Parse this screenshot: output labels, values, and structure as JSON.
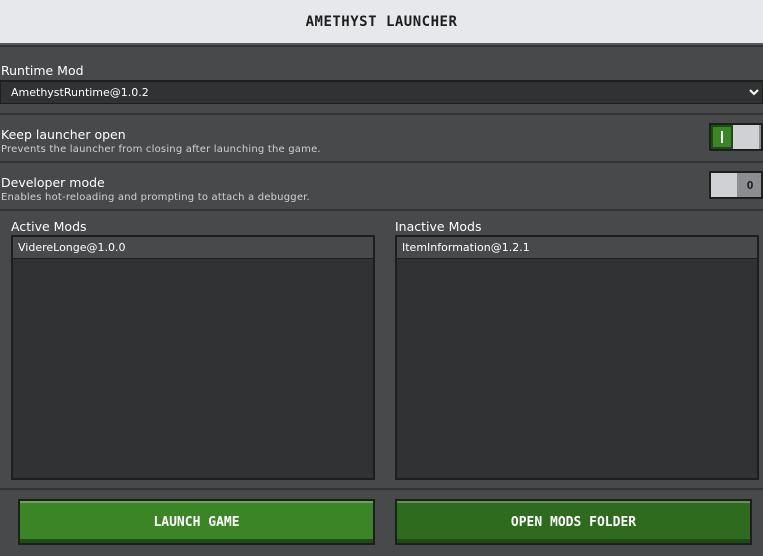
{
  "app": {
    "title": "AMETHYST LAUNCHER"
  },
  "runtime": {
    "label": "Runtime Mod",
    "selected": "AmethystRuntime@1.0.2"
  },
  "settings": [
    {
      "label": "Keep launcher open",
      "description": "Prevents the launcher from closing after launching the game.",
      "state": "on",
      "state_label": "I"
    },
    {
      "label": "Developer mode",
      "description": "Enables hot-reloading and prompting to attach a debugger.",
      "state": "off",
      "state_label": "O"
    }
  ],
  "mods": {
    "active": {
      "title": "Active Mods",
      "items": [
        "VidereLonge@1.0.0"
      ]
    },
    "inactive": {
      "title": "Inactive Mods",
      "items": [
        "ItemInformation@1.2.1"
      ]
    }
  },
  "actions": {
    "launch": "LAUNCH GAME",
    "open_folder": "OPEN MODS FOLDER"
  },
  "colors": {
    "accent": "#3c8527",
    "panel": "#48494a",
    "dark": "#313233",
    "titlebar": "#e6e8eb"
  },
  "icons": {
    "dropdown": "chevron-down-icon"
  }
}
